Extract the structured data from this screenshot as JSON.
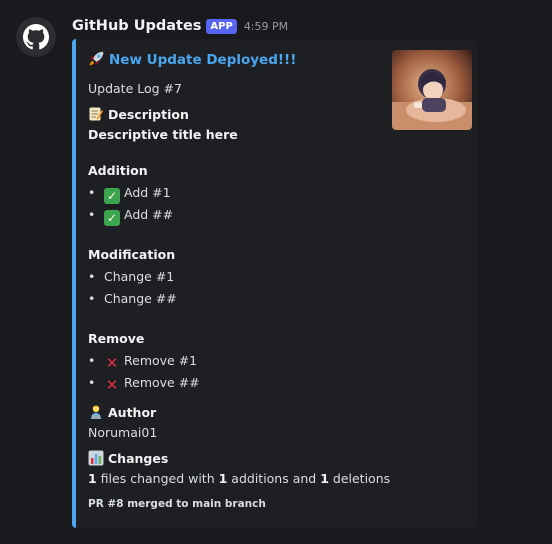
{
  "header": {
    "username": "GitHub Updates",
    "badge": "APP",
    "timestamp": "4:59 PM"
  },
  "embed": {
    "accent_color": "#4aa6ef",
    "title_icon": "rocket-icon",
    "title": "New Update Deployed!!!",
    "subtitle": "Update Log #7",
    "description_heading": "Description",
    "description_icon": "memo-icon",
    "description_text": "Descriptive title here",
    "sections": {
      "addition": {
        "heading": "Addition",
        "items": [
          "Add #1",
          "Add ##"
        ],
        "icon": "check-mark-icon"
      },
      "modification": {
        "heading": "Modification",
        "items": [
          "Change #1",
          "Change ##"
        ]
      },
      "remove": {
        "heading": "Remove",
        "items": [
          "Remove #1",
          "Remove ##"
        ],
        "icon": "cross-mark-icon"
      }
    },
    "author_heading": "Author",
    "author_icon": "technologist-icon",
    "author_name": "Norumai01",
    "changes_heading": "Changes",
    "changes_icon": "bar-chart-icon",
    "changes": {
      "files": "1",
      "files_text": " files changed with ",
      "additions": "1",
      "additions_text": " additions and ",
      "deletions": "1",
      "deletions_text": " deletions"
    },
    "footer": "PR #8 merged to main branch"
  }
}
